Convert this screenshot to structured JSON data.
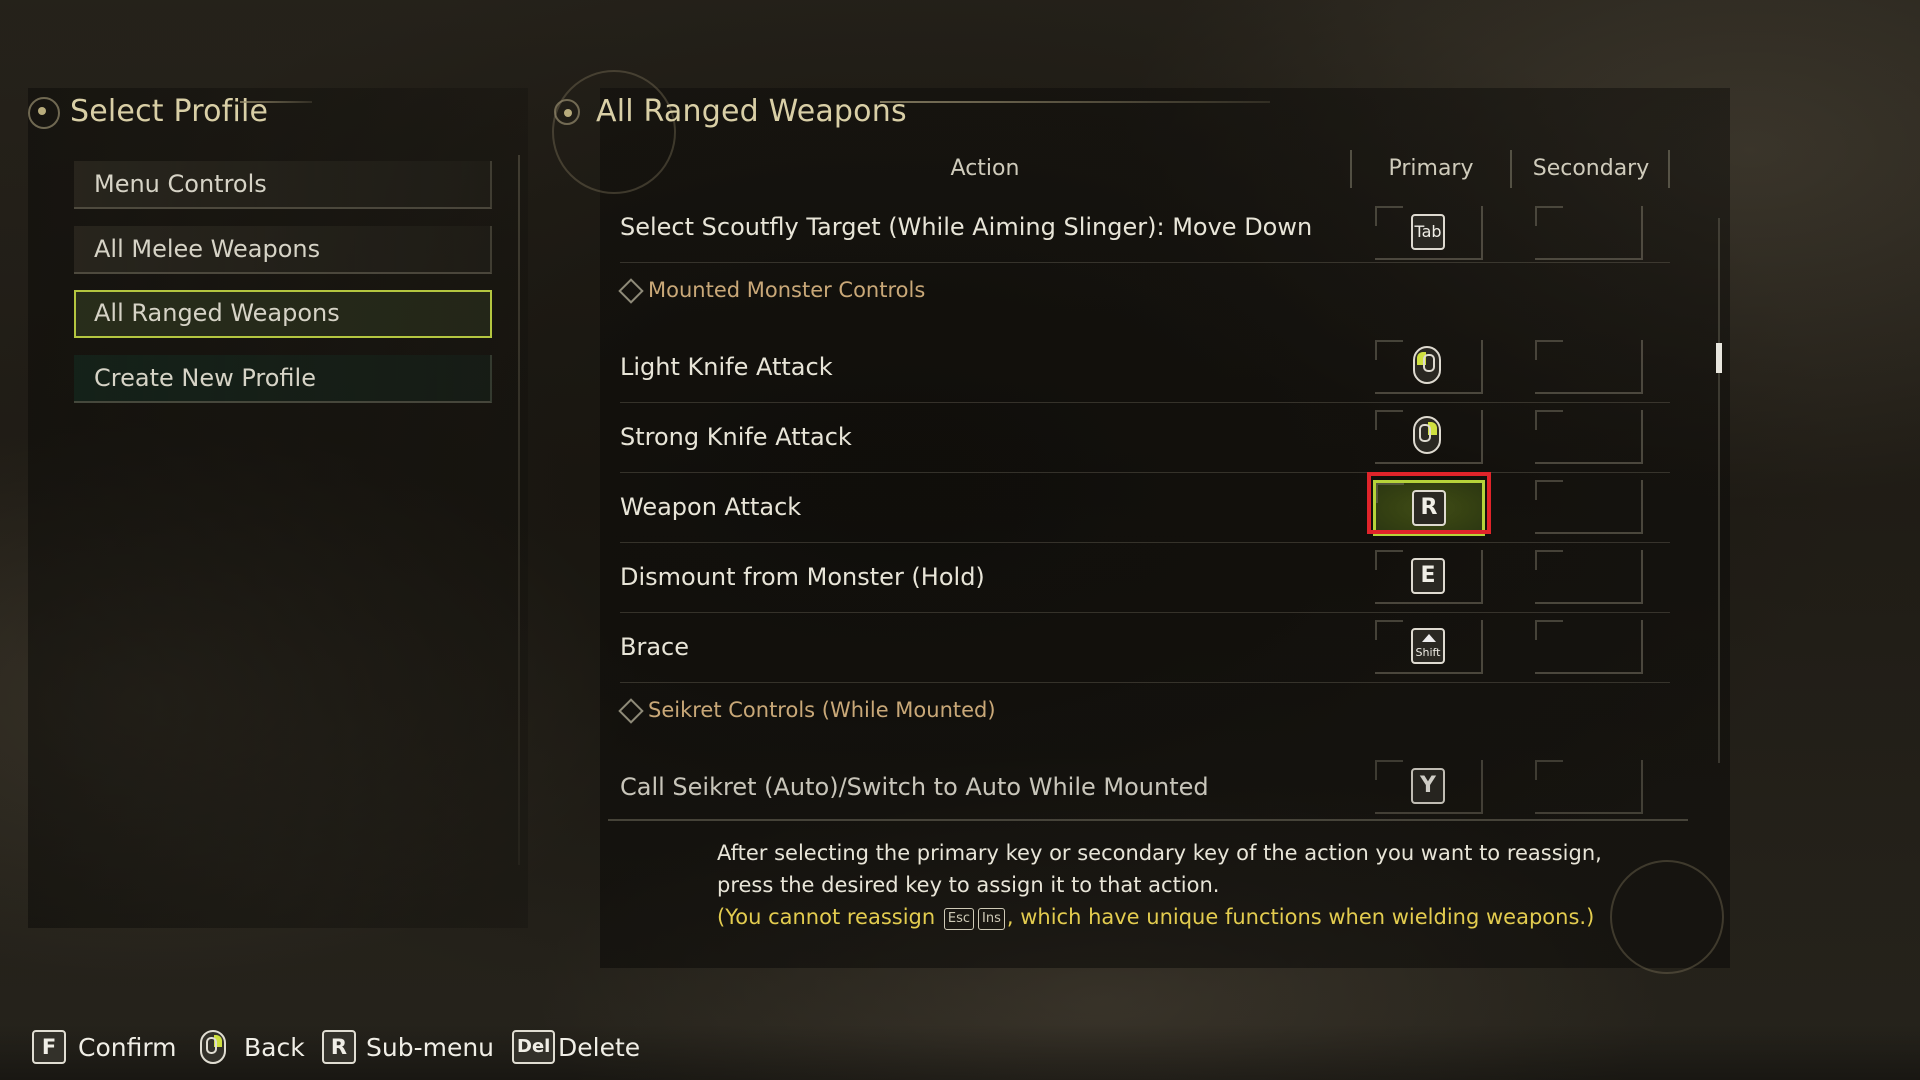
{
  "left_panel": {
    "title": "Select Profile",
    "items": [
      {
        "label": "Menu Controls"
      },
      {
        "label": "All Melee Weapons"
      },
      {
        "label": "All Ranged Weapons"
      },
      {
        "label": "Create New Profile"
      }
    ]
  },
  "right_panel": {
    "title": "All Ranged Weapons",
    "columns": {
      "action": "Action",
      "primary": "Primary",
      "secondary": "Secondary"
    },
    "rows": [
      {
        "label": "Select Scoutfly Target (While Aiming Slinger): Move Down",
        "primary_key": "Tab",
        "primary_icon": "key-tab-icon"
      },
      {
        "section": "Mounted Monster Controls"
      },
      {
        "label": "Light Knife Attack",
        "primary_key": "",
        "primary_icon": "mouse-left-button-icon"
      },
      {
        "label": "Strong Knife Attack",
        "primary_key": "",
        "primary_icon": "mouse-right-button-icon"
      },
      {
        "label": "Weapon Attack",
        "primary_key": "R",
        "primary_icon": "key-r-icon",
        "selected": true
      },
      {
        "label": "Dismount from Monster (Hold)",
        "primary_key": "E",
        "primary_icon": "key-e-icon"
      },
      {
        "label": "Brace",
        "primary_key": "Shift",
        "primary_icon": "key-shift-icon"
      },
      {
        "section": "Seikret Controls (While Mounted)"
      },
      {
        "label": "Call Seikret (Auto)/Switch to Auto While Mounted",
        "primary_key": "Y",
        "primary_icon": "key-y-icon"
      }
    ]
  },
  "info": {
    "line1": "After selecting the primary key or secondary key of the action you want to reassign,",
    "line2": "press the desired key to assign it to that action.",
    "line3_prefix": "(You cannot reassign",
    "key1": "Esc",
    "key2": "Ins",
    "line3_suffix": ", which have unique functions when wielding weapons.)"
  },
  "footer": {
    "hints": [
      {
        "key": "F",
        "label": "Confirm"
      },
      {
        "key": "",
        "icon": "mouse-right-button-icon",
        "label": "Back"
      },
      {
        "key": "R",
        "label": "Sub-menu"
      },
      {
        "key": "Del",
        "label": "Delete"
      }
    ]
  },
  "colors": {
    "accent_selected": "#b7d33a",
    "selection_outline": "#e0242a",
    "section_text": "#c9a878",
    "info_highlight": "#e3cc4f"
  }
}
